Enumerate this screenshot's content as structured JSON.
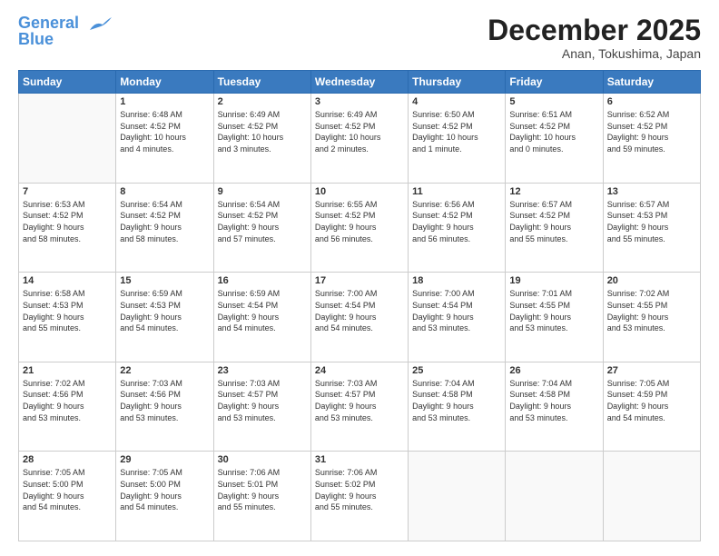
{
  "header": {
    "logo_line1": "General",
    "logo_line2": "Blue",
    "month": "December 2025",
    "location": "Anan, Tokushima, Japan"
  },
  "weekdays": [
    "Sunday",
    "Monday",
    "Tuesday",
    "Wednesday",
    "Thursday",
    "Friday",
    "Saturday"
  ],
  "weeks": [
    [
      {
        "day": "",
        "info": ""
      },
      {
        "day": "1",
        "info": "Sunrise: 6:48 AM\nSunset: 4:52 PM\nDaylight: 10 hours\nand 4 minutes."
      },
      {
        "day": "2",
        "info": "Sunrise: 6:49 AM\nSunset: 4:52 PM\nDaylight: 10 hours\nand 3 minutes."
      },
      {
        "day": "3",
        "info": "Sunrise: 6:49 AM\nSunset: 4:52 PM\nDaylight: 10 hours\nand 2 minutes."
      },
      {
        "day": "4",
        "info": "Sunrise: 6:50 AM\nSunset: 4:52 PM\nDaylight: 10 hours\nand 1 minute."
      },
      {
        "day": "5",
        "info": "Sunrise: 6:51 AM\nSunset: 4:52 PM\nDaylight: 10 hours\nand 0 minutes."
      },
      {
        "day": "6",
        "info": "Sunrise: 6:52 AM\nSunset: 4:52 PM\nDaylight: 9 hours\nand 59 minutes."
      }
    ],
    [
      {
        "day": "7",
        "info": "Sunrise: 6:53 AM\nSunset: 4:52 PM\nDaylight: 9 hours\nand 58 minutes."
      },
      {
        "day": "8",
        "info": "Sunrise: 6:54 AM\nSunset: 4:52 PM\nDaylight: 9 hours\nand 58 minutes."
      },
      {
        "day": "9",
        "info": "Sunrise: 6:54 AM\nSunset: 4:52 PM\nDaylight: 9 hours\nand 57 minutes."
      },
      {
        "day": "10",
        "info": "Sunrise: 6:55 AM\nSunset: 4:52 PM\nDaylight: 9 hours\nand 56 minutes."
      },
      {
        "day": "11",
        "info": "Sunrise: 6:56 AM\nSunset: 4:52 PM\nDaylight: 9 hours\nand 56 minutes."
      },
      {
        "day": "12",
        "info": "Sunrise: 6:57 AM\nSunset: 4:52 PM\nDaylight: 9 hours\nand 55 minutes."
      },
      {
        "day": "13",
        "info": "Sunrise: 6:57 AM\nSunset: 4:53 PM\nDaylight: 9 hours\nand 55 minutes."
      }
    ],
    [
      {
        "day": "14",
        "info": "Sunrise: 6:58 AM\nSunset: 4:53 PM\nDaylight: 9 hours\nand 55 minutes."
      },
      {
        "day": "15",
        "info": "Sunrise: 6:59 AM\nSunset: 4:53 PM\nDaylight: 9 hours\nand 54 minutes."
      },
      {
        "day": "16",
        "info": "Sunrise: 6:59 AM\nSunset: 4:54 PM\nDaylight: 9 hours\nand 54 minutes."
      },
      {
        "day": "17",
        "info": "Sunrise: 7:00 AM\nSunset: 4:54 PM\nDaylight: 9 hours\nand 54 minutes."
      },
      {
        "day": "18",
        "info": "Sunrise: 7:00 AM\nSunset: 4:54 PM\nDaylight: 9 hours\nand 53 minutes."
      },
      {
        "day": "19",
        "info": "Sunrise: 7:01 AM\nSunset: 4:55 PM\nDaylight: 9 hours\nand 53 minutes."
      },
      {
        "day": "20",
        "info": "Sunrise: 7:02 AM\nSunset: 4:55 PM\nDaylight: 9 hours\nand 53 minutes."
      }
    ],
    [
      {
        "day": "21",
        "info": "Sunrise: 7:02 AM\nSunset: 4:56 PM\nDaylight: 9 hours\nand 53 minutes."
      },
      {
        "day": "22",
        "info": "Sunrise: 7:03 AM\nSunset: 4:56 PM\nDaylight: 9 hours\nand 53 minutes."
      },
      {
        "day": "23",
        "info": "Sunrise: 7:03 AM\nSunset: 4:57 PM\nDaylight: 9 hours\nand 53 minutes."
      },
      {
        "day": "24",
        "info": "Sunrise: 7:03 AM\nSunset: 4:57 PM\nDaylight: 9 hours\nand 53 minutes."
      },
      {
        "day": "25",
        "info": "Sunrise: 7:04 AM\nSunset: 4:58 PM\nDaylight: 9 hours\nand 53 minutes."
      },
      {
        "day": "26",
        "info": "Sunrise: 7:04 AM\nSunset: 4:58 PM\nDaylight: 9 hours\nand 53 minutes."
      },
      {
        "day": "27",
        "info": "Sunrise: 7:05 AM\nSunset: 4:59 PM\nDaylight: 9 hours\nand 54 minutes."
      }
    ],
    [
      {
        "day": "28",
        "info": "Sunrise: 7:05 AM\nSunset: 5:00 PM\nDaylight: 9 hours\nand 54 minutes."
      },
      {
        "day": "29",
        "info": "Sunrise: 7:05 AM\nSunset: 5:00 PM\nDaylight: 9 hours\nand 54 minutes."
      },
      {
        "day": "30",
        "info": "Sunrise: 7:06 AM\nSunset: 5:01 PM\nDaylight: 9 hours\nand 55 minutes."
      },
      {
        "day": "31",
        "info": "Sunrise: 7:06 AM\nSunset: 5:02 PM\nDaylight: 9 hours\nand 55 minutes."
      },
      {
        "day": "",
        "info": ""
      },
      {
        "day": "",
        "info": ""
      },
      {
        "day": "",
        "info": ""
      }
    ]
  ]
}
